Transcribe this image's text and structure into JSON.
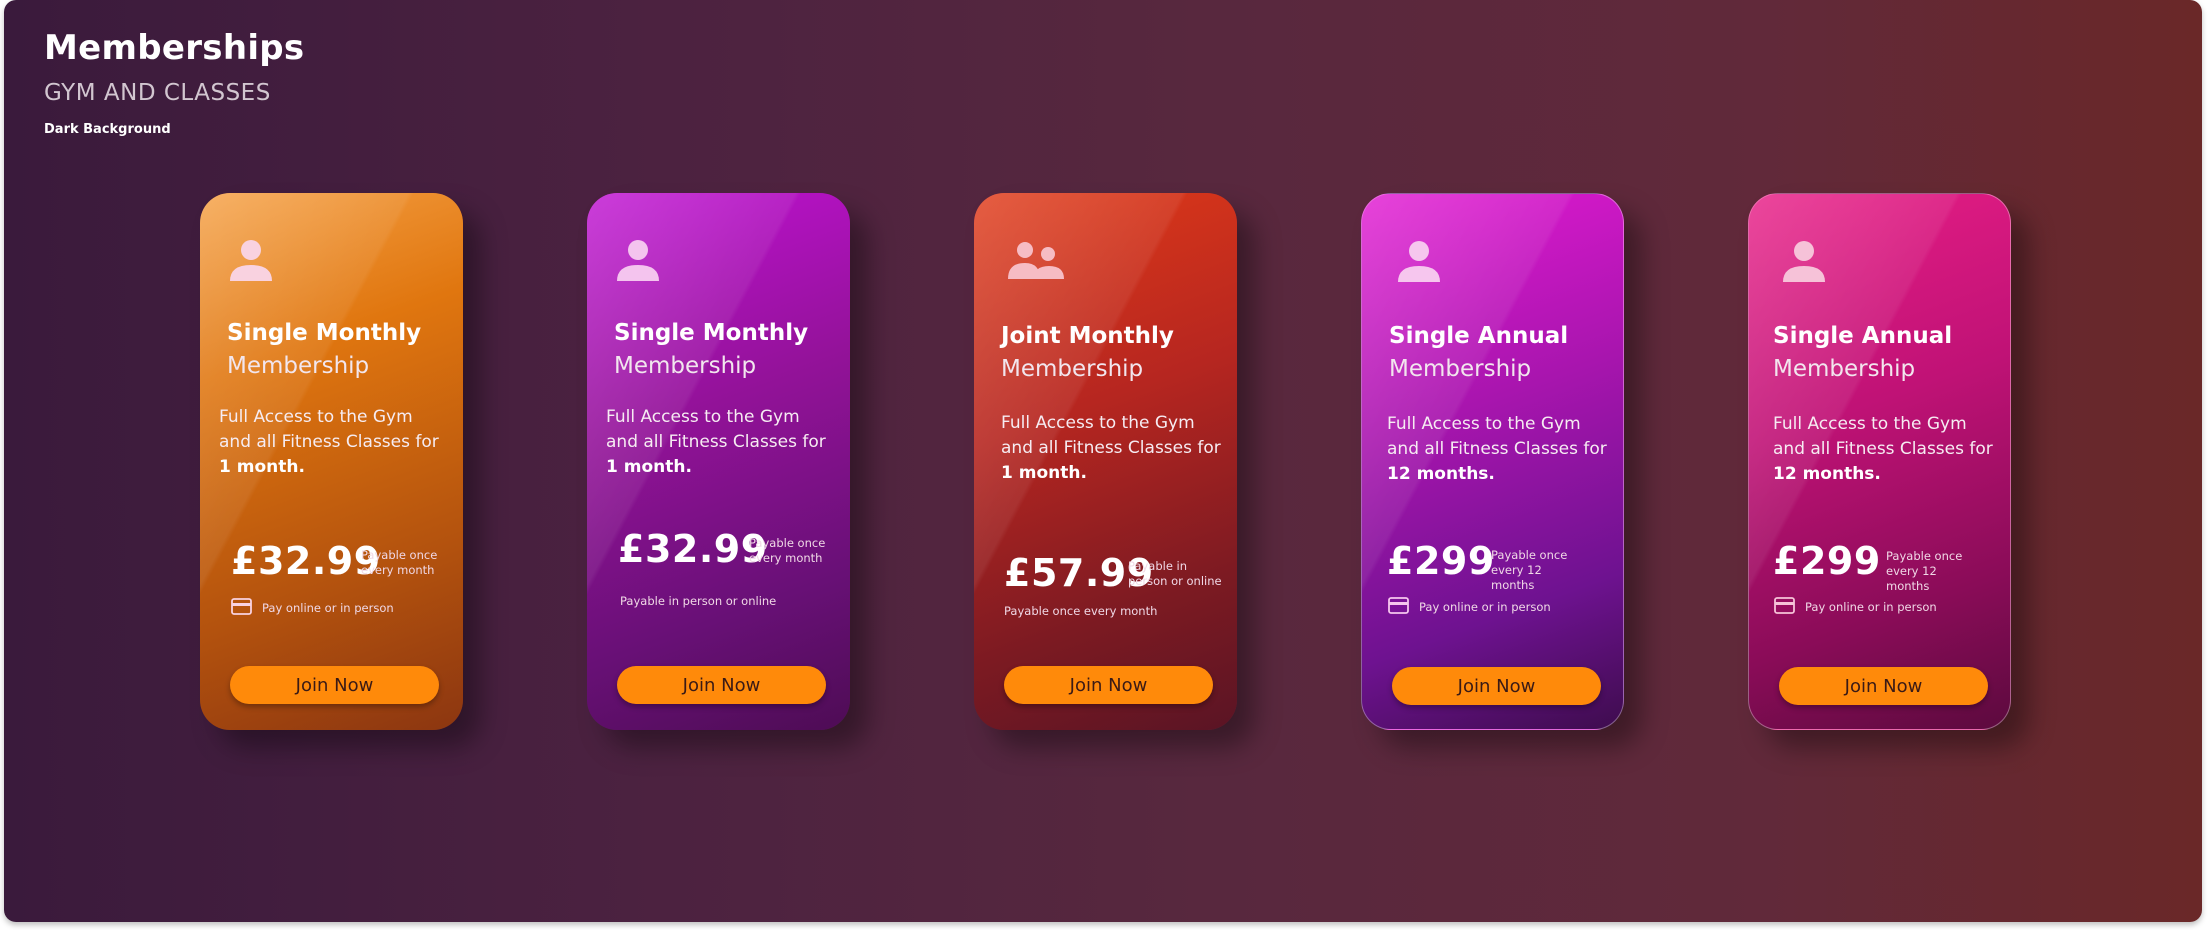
{
  "header": {
    "title": "Memberships",
    "subtitle": "GYM AND CLASSES",
    "note": "Dark Background"
  },
  "cards": [
    {
      "icon": "person-icon",
      "name_bold": "Single Monthly",
      "name_light": "Membership",
      "desc_prefix": "Full Access to the Gym and all Fitness Classes for ",
      "desc_bold": "1 month.",
      "price": "£32.99",
      "price_note": "Payable once every month",
      "pay_icon": "credit-card-icon",
      "pay_text": "Pay online or in person",
      "button": "Join Now"
    },
    {
      "icon": "person-icon",
      "name_bold": "Single Monthly",
      "name_light": "Membership",
      "desc_prefix": "Full Access to the Gym and all Fitness Classes for ",
      "desc_bold": "1 month.",
      "price": "£32.99",
      "price_note": "Payable once every month",
      "pay_text": "Payable in person or online",
      "button": "Join Now"
    },
    {
      "icon": "people-icon",
      "name_bold": "Joint Monthly",
      "name_light": "Membership",
      "desc_prefix": "Full Access to the Gym and all Fitness Classes for ",
      "desc_bold": "1 month.",
      "price": "£57.99",
      "price_note": "Payable in person or online",
      "pay_text": "Payable once every month",
      "button": "Join Now"
    },
    {
      "icon": "person-icon",
      "name_bold": "Single Annual",
      "name_light": "Membership",
      "desc_prefix": "Full Access to the Gym and all Fitness Classes for ",
      "desc_bold": "12 months.",
      "price": "£299",
      "price_note": "Payable once every 12 months",
      "pay_icon": "credit-card-icon",
      "pay_text": "Pay online or in person",
      "button": "Join Now"
    },
    {
      "icon": "person-icon",
      "name_bold": "Single Annual",
      "name_light": "Membership",
      "desc_prefix": "Full Access to the Gym and all Fitness Classes for ",
      "desc_bold": "12 months.",
      "price": "£299",
      "price_note": "Payable once every 12 months",
      "pay_icon": "credit-card-icon",
      "pay_text": "Pay online or in person",
      "button": "Join Now"
    }
  ],
  "colors": {
    "button": "#ff8a0a",
    "card_orange": "#e0760f",
    "card_purple": "#931299",
    "card_red": "#b62620",
    "card_magenta": "#a815ae",
    "card_pink": "#c01276"
  }
}
